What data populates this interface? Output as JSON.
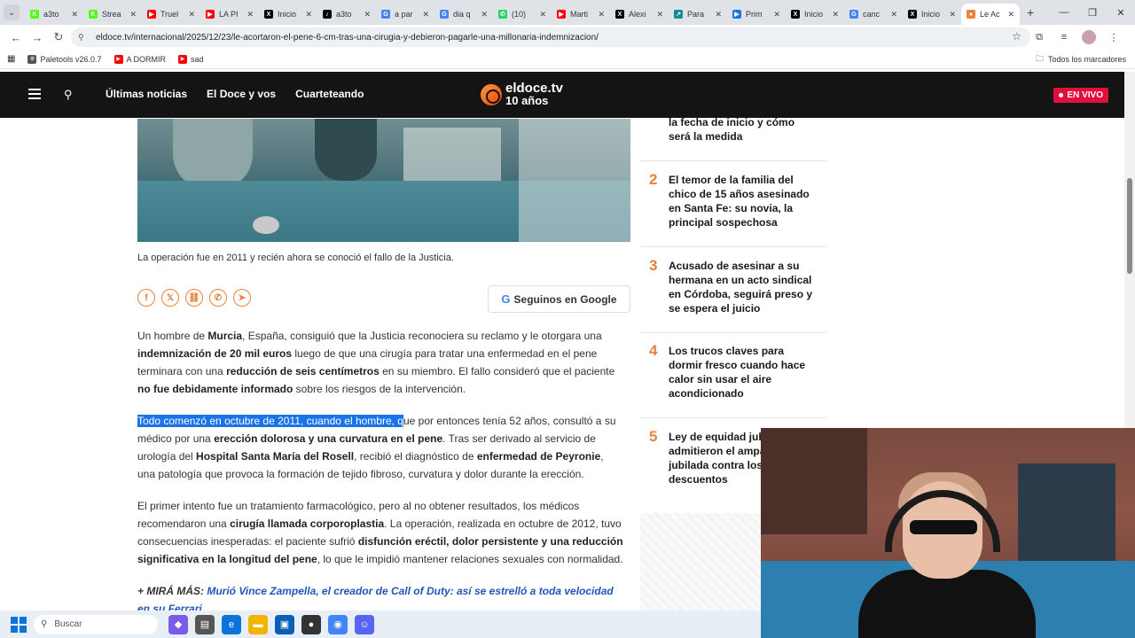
{
  "browser": {
    "tabs": [
      {
        "title": "a3to",
        "color": "#53fc18",
        "glyph": "K"
      },
      {
        "title": "Strea",
        "color": "#53fc18",
        "glyph": "K"
      },
      {
        "title": "Truel",
        "color": "#ff0000",
        "glyph": "▶"
      },
      {
        "title": "LA PI",
        "color": "#ff0000",
        "glyph": "▶"
      },
      {
        "title": "Inicio",
        "color": "#000000",
        "glyph": "X"
      },
      {
        "title": "a3to",
        "color": "#000000",
        "glyph": "♪"
      },
      {
        "title": "a par",
        "color": "#4285f4",
        "glyph": "G"
      },
      {
        "title": "dia q",
        "color": "#4285f4",
        "glyph": "G"
      },
      {
        "title": "(10)",
        "color": "#25d366",
        "glyph": "✆"
      },
      {
        "title": "Marti",
        "color": "#ff0000",
        "glyph": "▶"
      },
      {
        "title": "Alexi",
        "color": "#000000",
        "glyph": "X"
      },
      {
        "title": "Para",
        "color": "#0a8f8f",
        "glyph": "↗"
      },
      {
        "title": "Prim",
        "color": "#1a73e8",
        "glyph": "▶"
      },
      {
        "title": "Inicio",
        "color": "#000000",
        "glyph": "X"
      },
      {
        "title": "canc",
        "color": "#4285f4",
        "glyph": "G"
      },
      {
        "title": "Inicio",
        "color": "#000000",
        "glyph": "X"
      },
      {
        "title": "Le Ac",
        "color": "#e8823a",
        "glyph": "●",
        "active": true
      }
    ],
    "url": "eldoce.tv/internacional/2025/12/23/le-acortaron-el-pene-6-cm-tras-una-cirugia-y-debieron-pagarle-una-millonaria-indemnizacion/",
    "bookmarks": [
      {
        "label": "Paletools v26.0.7",
        "color": "#555555",
        "glyph": "⚙"
      },
      {
        "label": "A DORMIR",
        "color": "#ff0000",
        "glyph": "▶"
      },
      {
        "label": "sad",
        "color": "#ff0000",
        "glyph": "▶"
      }
    ],
    "all_bookmarks": "Todos los marcadores"
  },
  "site": {
    "nav": [
      "Últimas noticias",
      "El Doce y vos",
      "Cuarteteando"
    ],
    "logo_line1": "eldoce.tv",
    "logo_line2": "10 años",
    "live": "EN VIVO"
  },
  "article": {
    "caption": "La operación fue en 2011 y recién ahora se conoció el fallo de la Justicia.",
    "google_btn": "Seguinos en Google",
    "p1": [
      {
        "t": "Un hombre de "
      },
      {
        "t": "Murcia",
        "b": true
      },
      {
        "t": ", España, consiguió que la Justicia reconociera su reclamo y le otorgara una "
      },
      {
        "t": "indemnización de 20 mil euros",
        "b": true
      },
      {
        "t": " luego de que una cirugía para tratar una enfermedad en el pene terminara con una "
      },
      {
        "t": "reducción de seis centímetros",
        "b": true
      },
      {
        "t": " en su miembro. El fallo consideró que el paciente "
      },
      {
        "t": "no fue debidamente informado",
        "b": true
      },
      {
        "t": " sobre los riesgos de la intervención."
      }
    ],
    "p2": [
      {
        "t": "Todo comenzó en octubre de 2011, cuando el hombre, q",
        "h": true
      },
      {
        "t": "ue por entonces tenía 52 años, consultó a su médico por una "
      },
      {
        "t": "erección dolorosa y una curvatura en el pene",
        "b": true
      },
      {
        "t": ". Tras ser derivado al servicio de urología del "
      },
      {
        "t": "Hospital Santa María del Rosell",
        "b": true
      },
      {
        "t": ", recibió el diagnóstico de "
      },
      {
        "t": "enfermedad de Peyronie",
        "b": true
      },
      {
        "t": ", una patología que provoca la formación de tejido fibroso, curvatura y dolor durante la erección."
      }
    ],
    "p3": [
      {
        "t": "El primer intento fue un tratamiento farmacológico, pero al no obtener resultados, los médicos recomendaron una "
      },
      {
        "t": "cirugía llamada corporoplastia",
        "b": true
      },
      {
        "t": ". La operación, realizada en octubre de 2012, tuvo consecuencias inesperadas: el paciente sufrió "
      },
      {
        "t": "disfunción eréctil, dolor persistente y una reducción significativa en la longitud del pene",
        "b": true
      },
      {
        "t": ", lo que le impidió mantener relaciones sexuales con normalidad."
      }
    ],
    "more_prefix": "+ MIRÁ MÁS:",
    "more_link": "Murió Vince Zampella, el creador de Call of Duty: así se estrelló a toda velocidad en su Ferrari"
  },
  "sidebar": [
    {
      "num": "",
      "text": "la fecha de inicio y cómo será la medida"
    },
    {
      "num": "2",
      "text": "El temor de la familia del chico de 15 años asesinado en Santa Fe: su novia, la principal sospechosa"
    },
    {
      "num": "3",
      "text": "Acusado de asesinar a su hermana en un acto sindical en Córdoba, seguirá preso y se espera el juicio"
    },
    {
      "num": "4",
      "text": "Los trucos claves para dormir fresco cuando hace calor sin usar el aire acondicionado"
    },
    {
      "num": "5",
      "text": "Ley de equidad jubilatoria: admitieron el amparo de una jubilada contra los descuentos"
    }
  ],
  "taskbar": {
    "search_placeholder": "Buscar"
  }
}
